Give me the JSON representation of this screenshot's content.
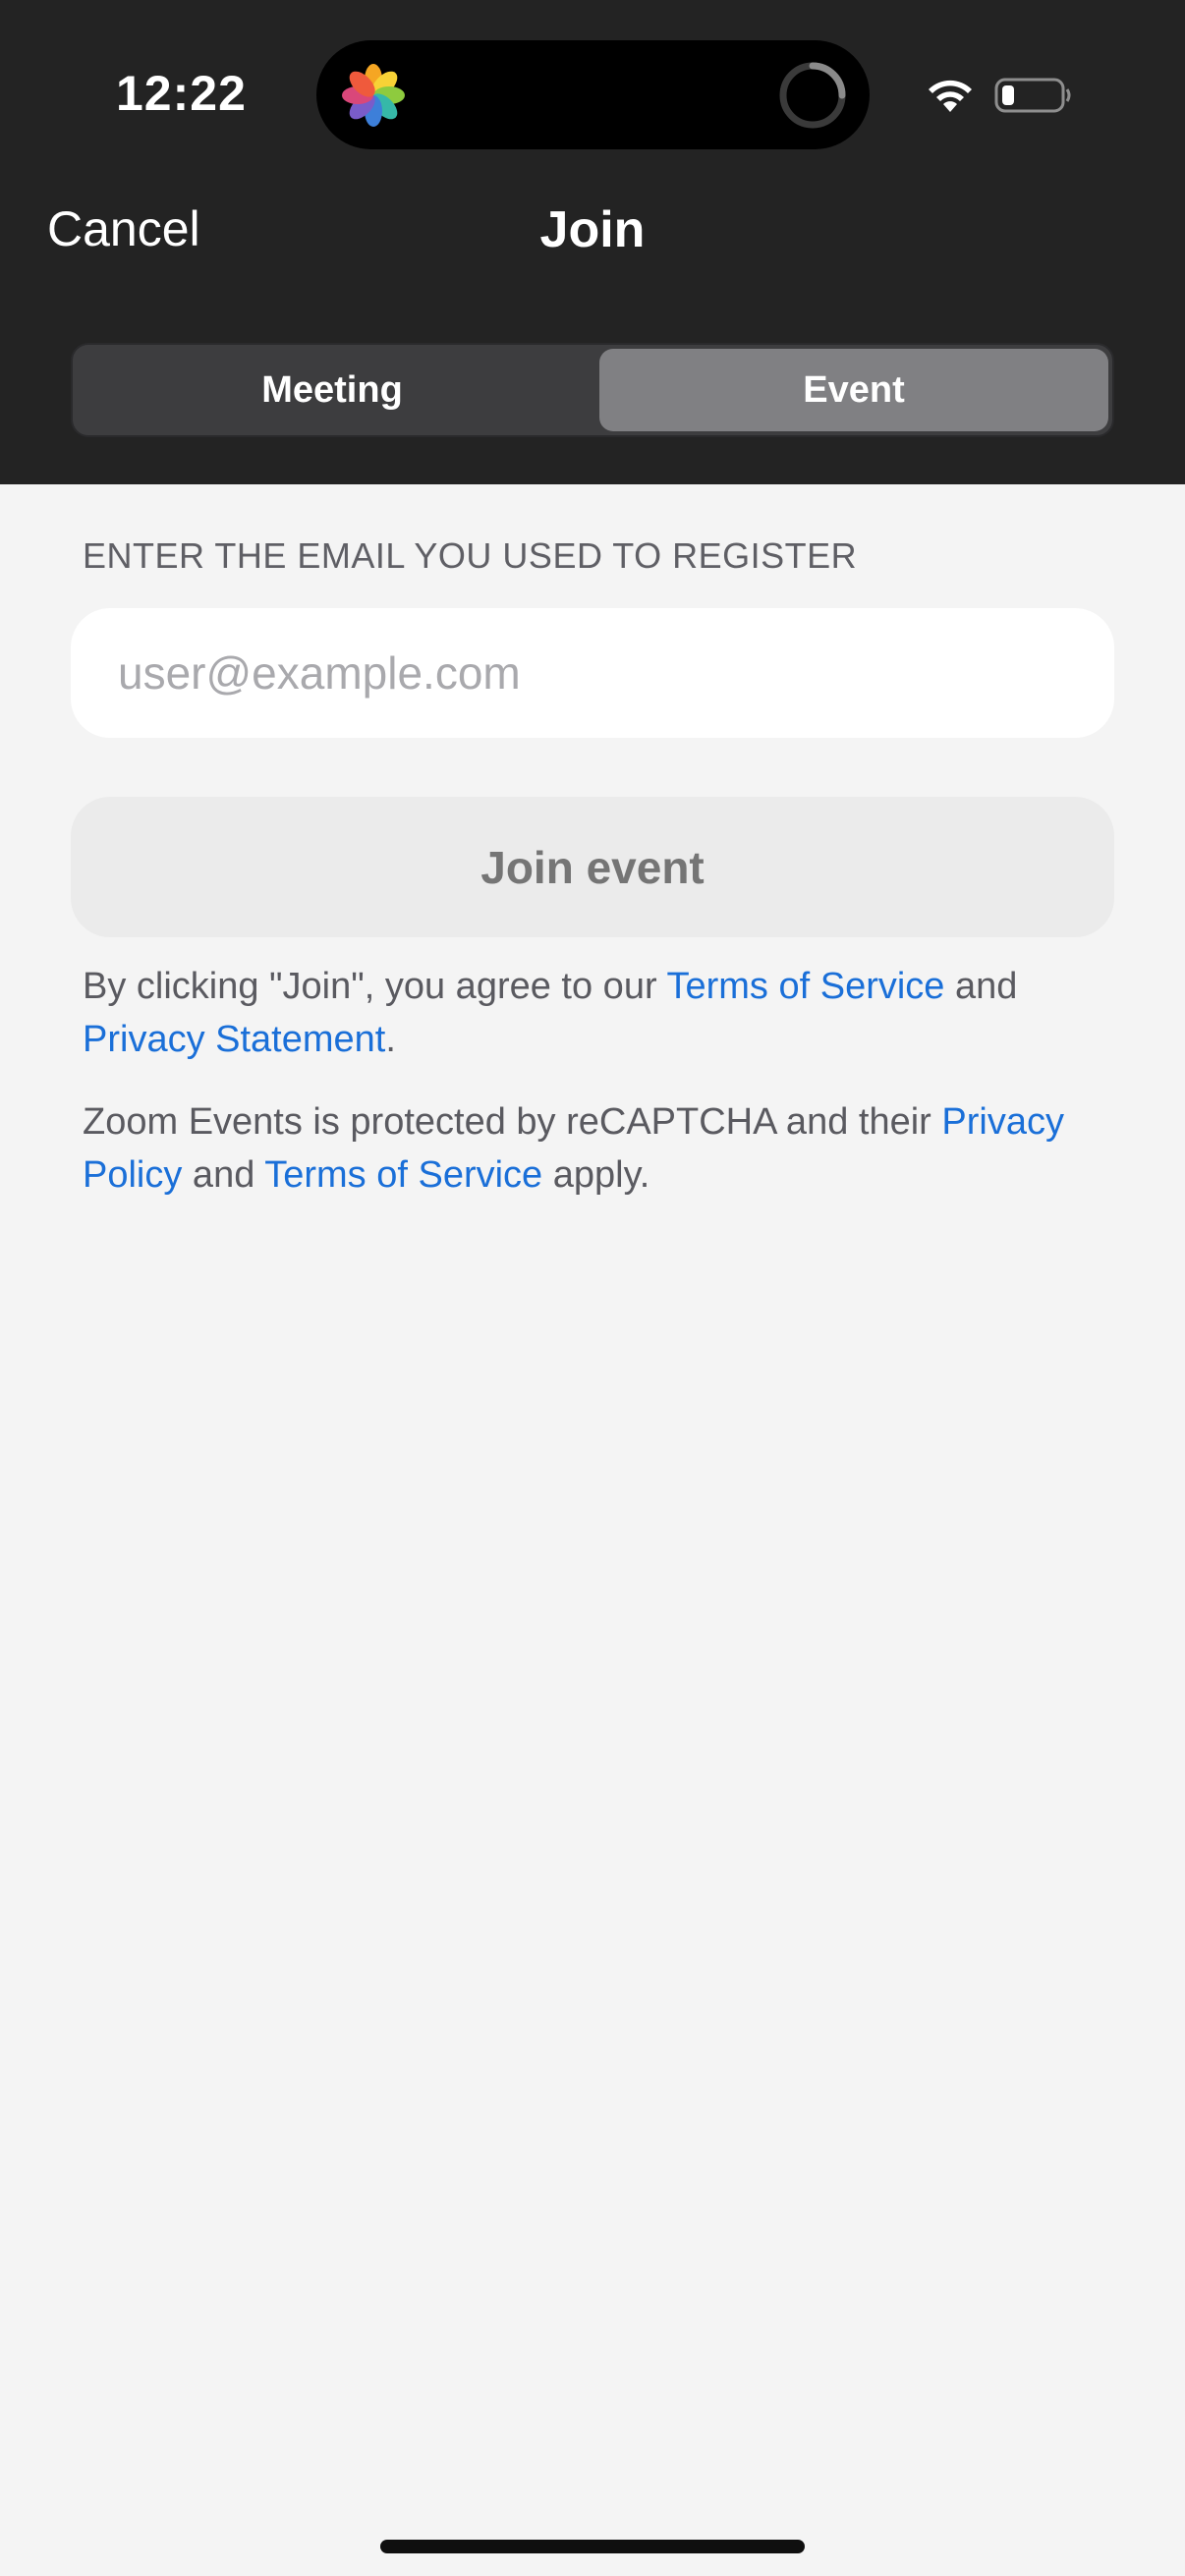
{
  "status_bar": {
    "time": "12:22"
  },
  "nav": {
    "cancel_label": "Cancel",
    "title": "Join"
  },
  "segments": {
    "meeting_label": "Meeting",
    "event_label": "Event",
    "selected": "Event"
  },
  "form": {
    "email_label": "ENTER THE EMAIL YOU USED TO REGISTER",
    "email_placeholder": "user@example.com",
    "email_value": "",
    "join_button_label": "Join event"
  },
  "legal": {
    "p1_prefix": "By clicking \"Join\", you agree to our ",
    "p1_terms_link": "Terms of Service",
    "p1_middle": " and ",
    "p1_privacy_link": "Privacy Statement",
    "p1_suffix": ".",
    "p2_prefix": "Zoom Events is protected by reCAPTCHA and their ",
    "p2_privacy_link": "Privacy Policy",
    "p2_middle": " and ",
    "p2_terms_link": "Terms of Service",
    "p2_suffix": " apply."
  },
  "colors": {
    "header_bg": "#232323",
    "page_bg": "#f4f4f4",
    "link": "#1a6fd8",
    "segment_selected": "#808083"
  }
}
